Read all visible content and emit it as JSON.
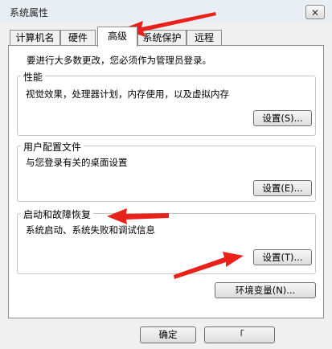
{
  "window": {
    "title": "系统属性",
    "close_icon": "close-icon"
  },
  "tabs": [
    "计算机名",
    "硬件",
    "高级",
    "系统保护",
    "远程"
  ],
  "active_tab": "高级",
  "admin_notice": "要进行大多数更改，您必须作为管理员登录。",
  "performance": {
    "legend": "性能",
    "description": "视觉效果，处理器计划，内存使用，以及虚拟内存",
    "button": "设置(S)..."
  },
  "user_profiles": {
    "legend": "用户配置文件",
    "description": "与您登录有关的桌面设置",
    "button": "设置(E)..."
  },
  "startup_recovery": {
    "legend": "启动和故障恢复",
    "description": "系统启动、系统失败和调试信息",
    "button": "设置(T)..."
  },
  "env_button": "环境变量(N)...",
  "footer": {
    "ok": "确定",
    "cancel": "「"
  },
  "annotation_color": "#e8221b"
}
